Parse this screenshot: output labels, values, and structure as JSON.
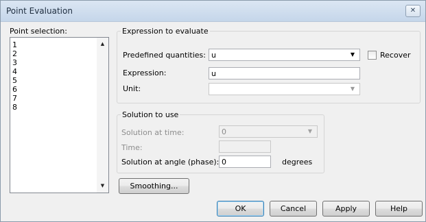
{
  "window": {
    "title": "Point Evaluation"
  },
  "point_selection": {
    "label": "Point selection:",
    "items": [
      "1",
      "2",
      "3",
      "4",
      "5",
      "6",
      "7",
      "8"
    ]
  },
  "expression_group": {
    "title": "Expression to evaluate",
    "predefined_label": "Predefined quantities:",
    "predefined_value": "u",
    "recover_label": "Recover",
    "expression_label": "Expression:",
    "expression_value": "u",
    "unit_label": "Unit:",
    "unit_value": ""
  },
  "solution_group": {
    "title": "Solution to use",
    "time_label": "Solution at time:",
    "time_value": "0",
    "time_field_label": "Time:",
    "time_field_value": "",
    "angle_label": "Solution at angle (phase):",
    "angle_value": "0",
    "angle_unit": "degrees"
  },
  "buttons": {
    "smoothing": "Smoothing...",
    "ok": "OK",
    "cancel": "Cancel",
    "apply": "Apply",
    "help": "Help"
  }
}
